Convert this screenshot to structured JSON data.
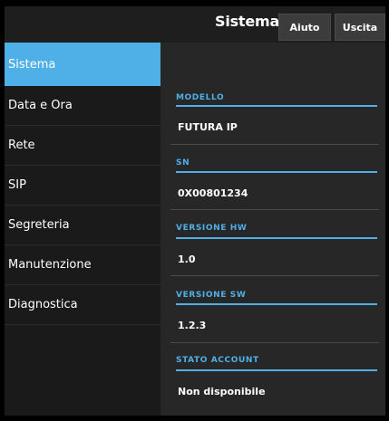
{
  "header": {
    "title": "Sistema",
    "help_label": "Aiuto",
    "exit_label": "Uscita"
  },
  "sidebar": {
    "items": [
      {
        "label": "Sistema",
        "active": true
      },
      {
        "label": "Data e Ora"
      },
      {
        "label": "Rete"
      },
      {
        "label": "SIP"
      },
      {
        "label": "Segreteria"
      },
      {
        "label": "Manutenzione"
      },
      {
        "label": "Diagnostica"
      }
    ]
  },
  "fields": [
    {
      "label": "MODELLO",
      "value": "FUTURA IP"
    },
    {
      "label": "SN",
      "value": "0X00801234"
    },
    {
      "label": "VERSIONE HW",
      "value": "1.0"
    },
    {
      "label": "VERSIONE SW",
      "value": "1.2.3"
    },
    {
      "label": "STATO ACCOUNT",
      "value": "Non disponibile"
    }
  ],
  "colors": {
    "accent": "#4fb0e8",
    "panel": "#272727",
    "sidebar": "#1a1a1a"
  }
}
